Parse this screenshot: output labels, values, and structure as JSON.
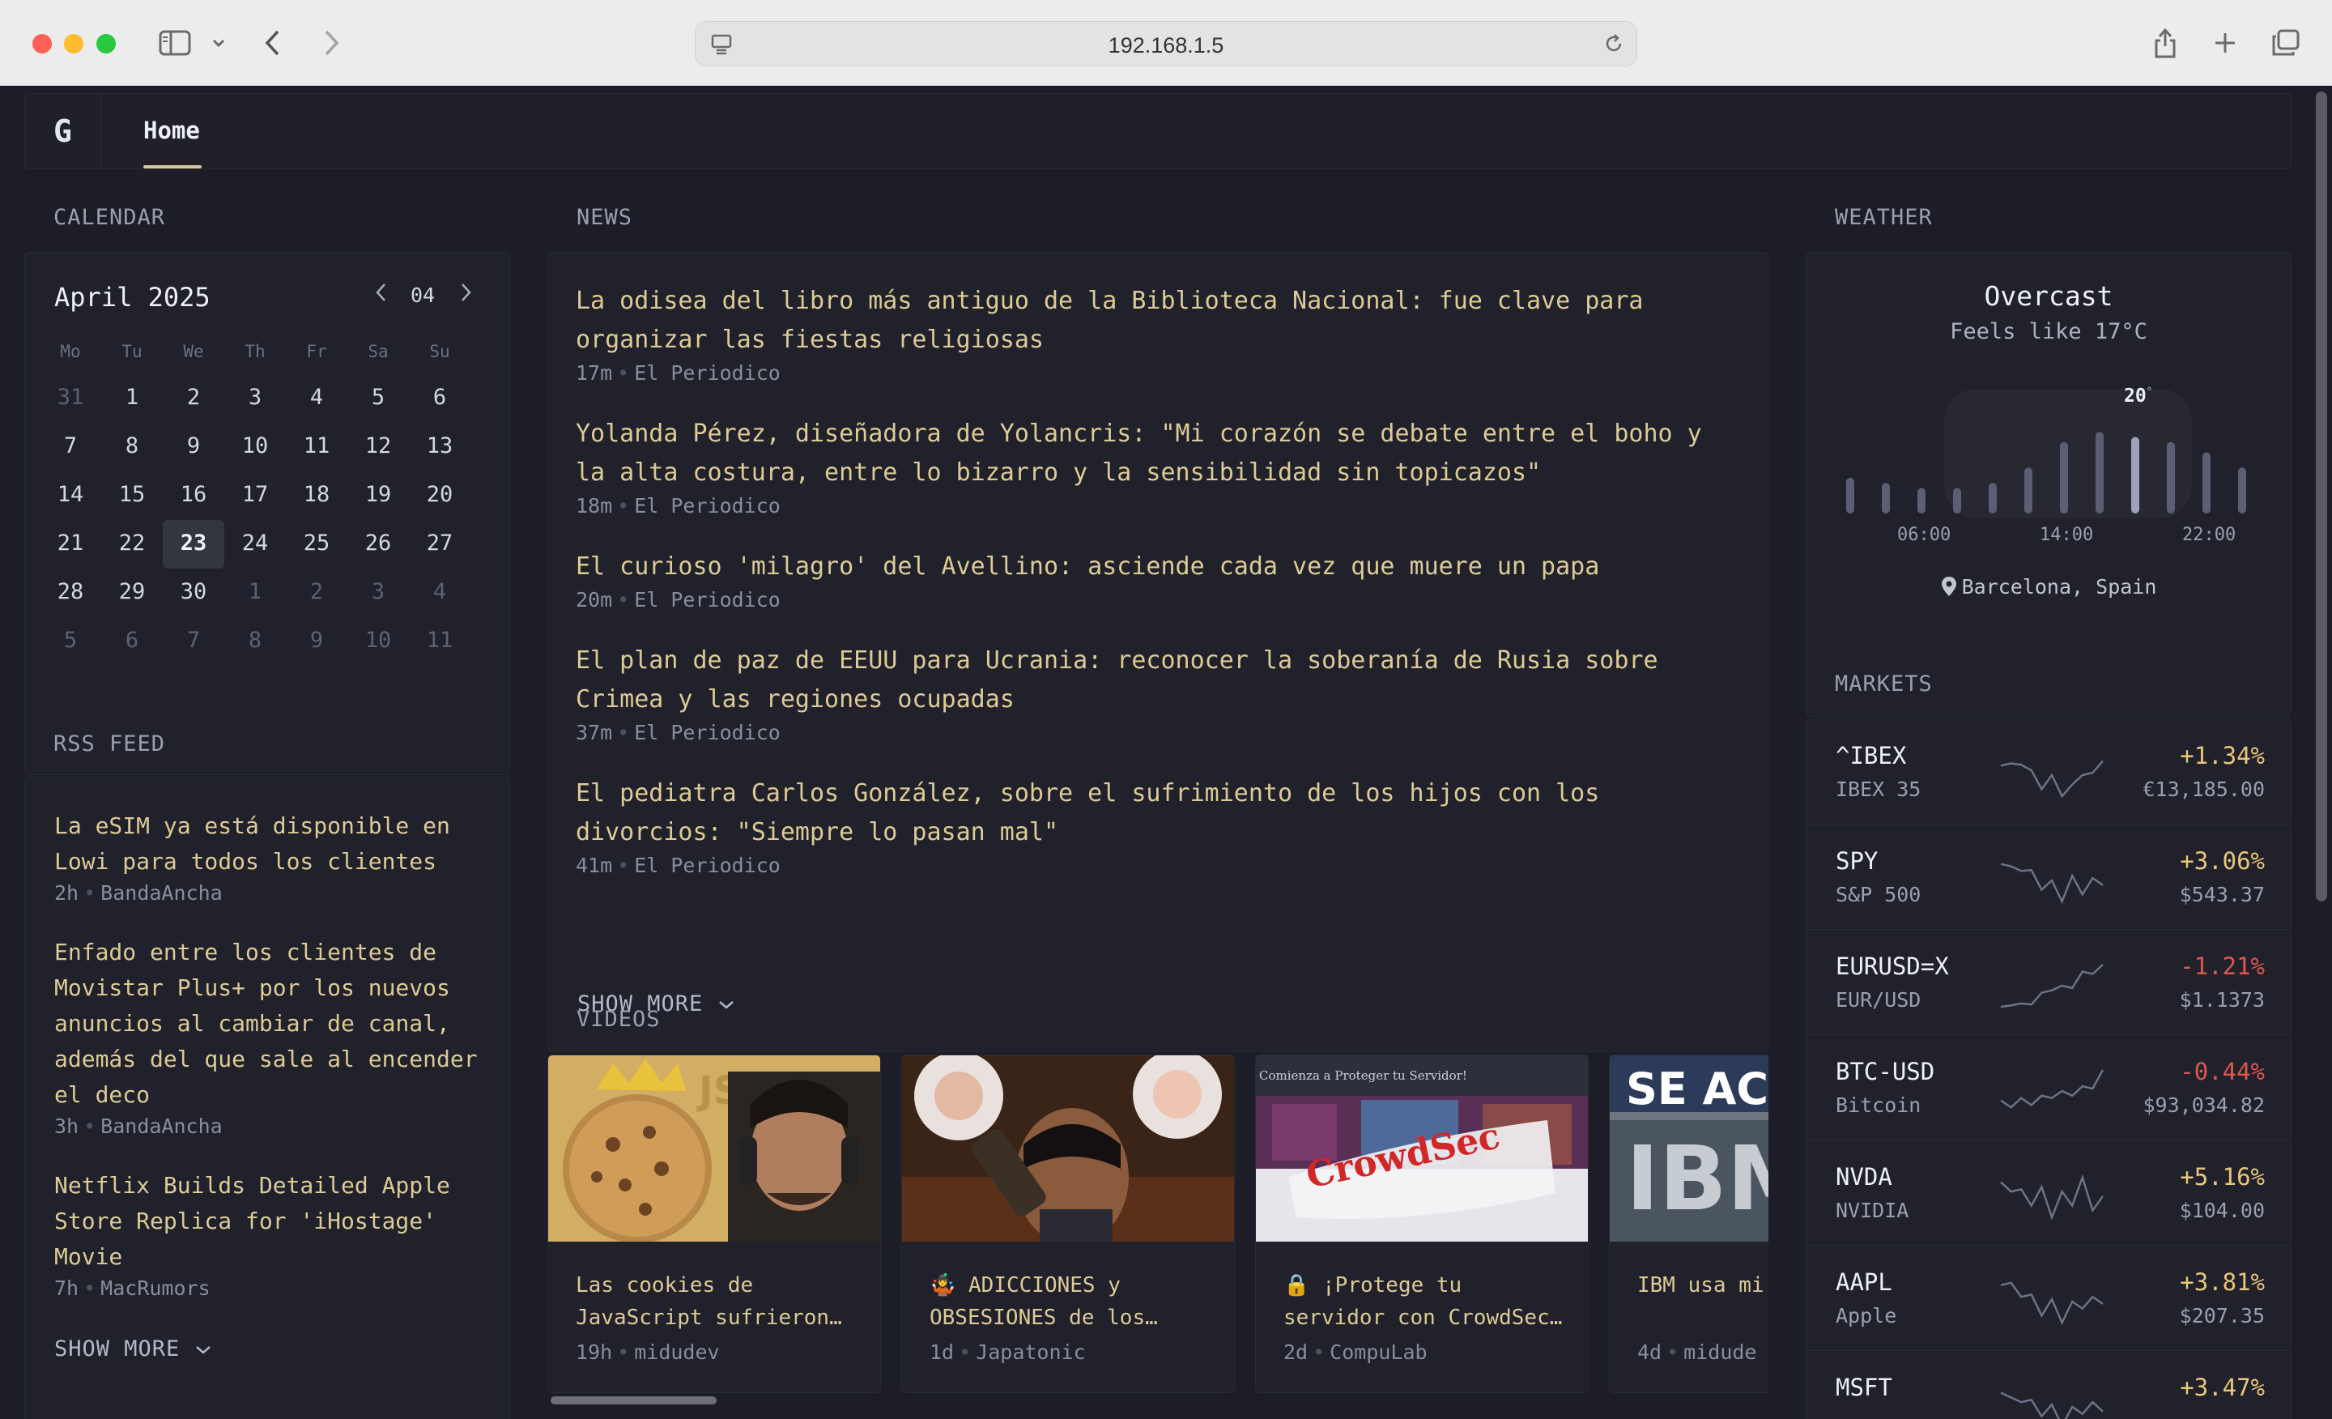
{
  "browser": {
    "url": "192.168.1.5"
  },
  "nav": {
    "logo": "G",
    "home_label": "Home"
  },
  "calendar": {
    "section_title": "CALENDAR",
    "month_label": "April 2025",
    "month_number": "04",
    "weekdays": [
      "Mo",
      "Tu",
      "We",
      "Th",
      "Fr",
      "Sa",
      "Su"
    ],
    "weeks": [
      [
        "31",
        "1",
        "2",
        "3",
        "4",
        "5",
        "6"
      ],
      [
        "7",
        "8",
        "9",
        "10",
        "11",
        "12",
        "13"
      ],
      [
        "14",
        "15",
        "16",
        "17",
        "18",
        "19",
        "20"
      ],
      [
        "21",
        "22",
        "23",
        "24",
        "25",
        "26",
        "27"
      ],
      [
        "28",
        "29",
        "30",
        "1",
        "2",
        "3",
        "4"
      ],
      [
        "5",
        "6",
        "7",
        "8",
        "9",
        "10",
        "11"
      ]
    ],
    "today": "23"
  },
  "rss": {
    "section_title": "RSS FEED",
    "items": [
      {
        "title": "La eSIM ya está disponible en Lowi para todos los clientes",
        "age": "2h",
        "source": "BandaAncha"
      },
      {
        "title": "Enfado entre los clientes de Movistar Plus+ por los nuevos anuncios al cambiar de canal, además del que sale al encender el deco",
        "age": "3h",
        "source": "BandaAncha"
      },
      {
        "title": "Netflix Builds Detailed Apple Store Replica for 'iHostage' Movie",
        "age": "7h",
        "source": "MacRumors"
      }
    ],
    "show_more": "SHOW MORE"
  },
  "news": {
    "section_title": "NEWS",
    "items": [
      {
        "title": "La odisea del libro más antiguo de la Biblioteca Nacional: fue clave para organizar las fiestas religiosas",
        "age": "17m",
        "source": "El Periodico"
      },
      {
        "title": "Yolanda Pérez, diseñadora de Yolancris: \"Mi corazón se debate entre el boho y la alta costura, entre lo bizarro y la sensibilidad sin topicazos\"",
        "age": "18m",
        "source": "El Periodico"
      },
      {
        "title": "El curioso 'milagro' del Avellino: asciende cada vez que muere un papa",
        "age": "20m",
        "source": "El Periodico"
      },
      {
        "title": "El plan de paz de EEUU para Ucrania: reconocer la soberanía de Rusia sobre Crimea y las regiones ocupadas",
        "age": "37m",
        "source": "El Periodico"
      },
      {
        "title": "El pediatra Carlos González, sobre el sufrimiento de los hijos con los divorcios: \"Siempre lo pasan mal\"",
        "age": "41m",
        "source": "El Periodico"
      }
    ],
    "show_more": "SHOW MORE"
  },
  "videos": {
    "section_title": "VIDEOS",
    "items": [
      {
        "title": "Las cookies de JavaScript sufrieron…",
        "age": "19h",
        "source": "midudev",
        "thumb_text": "JS"
      },
      {
        "title": "🤹 ADICCIONES y OBSESIONES de los…",
        "age": "1d",
        "source": "Japatonic",
        "thumb_text": ""
      },
      {
        "title": "🔒 ¡Protege tu servidor con CrowdSec…",
        "age": "2d",
        "source": "CompuLab",
        "thumb_text": "CrowdSec",
        "thumb_caption": "Comienza a Proteger tu Servidor!"
      },
      {
        "title": "IBM usa mi Python",
        "age": "4d",
        "source": "midude",
        "thumb_text": "SE ACAB",
        "thumb_text2": "IBM"
      }
    ]
  },
  "weather": {
    "section_title": "WEATHER",
    "condition": "Overcast",
    "feels_like": "Feels like 17°C",
    "current_temp": "20",
    "degree": "°",
    "times": [
      "06:00",
      "14:00",
      "22:00"
    ],
    "location": "Barcelona, Spain",
    "hourly_levels": [
      0.35,
      0.3,
      0.25,
      0.25,
      0.3,
      0.45,
      0.7,
      0.8,
      0.75,
      0.7,
      0.6,
      0.45
    ]
  },
  "markets": {
    "section_title": "MARKETS",
    "positive_color": "#e8c77a",
    "negative_color": "#e0564f",
    "items": [
      {
        "symbol": "^IBEX",
        "name": "IBEX 35",
        "change": "+1.34%",
        "price": "€13,185.00",
        "trend": "up",
        "spark": [
          0.7,
          0.75,
          0.72,
          0.6,
          0.2,
          0.5,
          0.05,
          0.3,
          0.5,
          0.55,
          0.8
        ]
      },
      {
        "symbol": "SPY",
        "name": "S&P 500",
        "change": "+3.06%",
        "price": "$543.37",
        "trend": "up",
        "spark": [
          0.85,
          0.8,
          0.7,
          0.72,
          0.3,
          0.5,
          0.05,
          0.6,
          0.2,
          0.55,
          0.4
        ]
      },
      {
        "symbol": "EURUSD=X",
        "name": "EUR/USD",
        "change": "-1.21%",
        "price": "$1.1373",
        "trend": "down",
        "spark": [
          0.05,
          0.08,
          0.12,
          0.1,
          0.35,
          0.4,
          0.5,
          0.45,
          0.8,
          0.75,
          0.95
        ]
      },
      {
        "symbol": "BTC-USD",
        "name": "Bitcoin",
        "change": "-0.44%",
        "price": "$93,034.82",
        "trend": "down",
        "spark": [
          0.3,
          0.15,
          0.35,
          0.2,
          0.4,
          0.35,
          0.5,
          0.4,
          0.6,
          0.55,
          0.95
        ]
      },
      {
        "symbol": "NVDA",
        "name": "NVIDIA",
        "change": "+5.16%",
        "price": "$104.00",
        "trend": "up",
        "spark": [
          0.8,
          0.6,
          0.65,
          0.3,
          0.7,
          0.05,
          0.6,
          0.3,
          0.9,
          0.2,
          0.5
        ]
      },
      {
        "symbol": "AAPL",
        "name": "Apple",
        "change": "+3.81%",
        "price": "$207.35",
        "trend": "up",
        "spark": [
          0.85,
          0.9,
          0.6,
          0.65,
          0.2,
          0.55,
          0.05,
          0.5,
          0.35,
          0.6,
          0.45
        ]
      },
      {
        "symbol": "MSFT",
        "name": "",
        "change": "+3.47%",
        "price": "",
        "trend": "up",
        "spark": [
          0.8,
          0.7,
          0.6,
          0.65,
          0.3,
          0.55,
          0.1,
          0.5,
          0.35,
          0.6,
          0.4
        ]
      }
    ]
  }
}
